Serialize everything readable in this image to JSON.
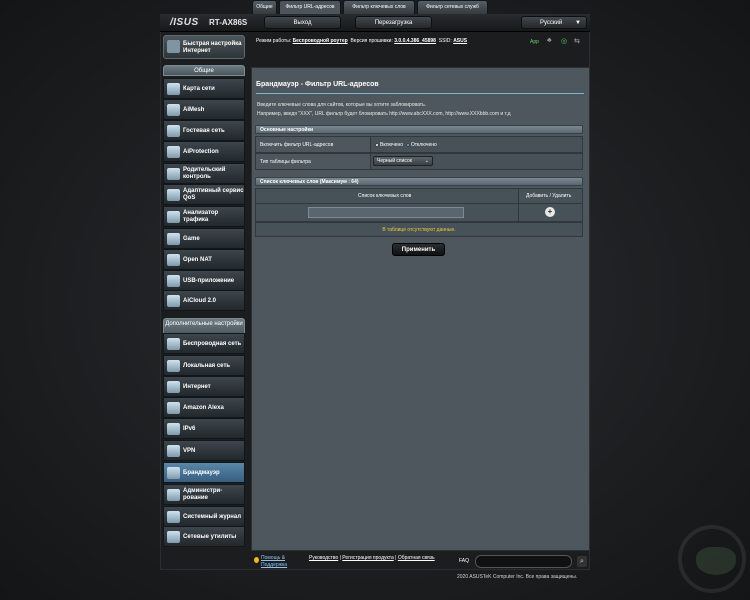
{
  "header": {
    "brand": "/ISUS",
    "model": "RT-AX86S",
    "logout_label": "Выход",
    "reboot_label": "Перезагрузка",
    "language": "Русский"
  },
  "status": {
    "mode_label": "Режим работы:",
    "mode_value": "Беспроводной роутер",
    "fw_label": "Версия прошивки:",
    "fw_value": "3.0.0.4.386_45898",
    "ssid_label": "SSID:",
    "ssid_value": "ASUS",
    "app_label": "App"
  },
  "sidebar": {
    "quick_setup": "Быстрая настройка Интернет",
    "general_header": "Общие",
    "general_items": [
      {
        "label": "Карта сети"
      },
      {
        "label": "AiMesh"
      },
      {
        "label": "Гостевая сеть"
      },
      {
        "label": "AiProtection"
      },
      {
        "label": "Родительский контроль"
      },
      {
        "label": "Адаптивный сервис QoS"
      },
      {
        "label": "Анализатор трафика"
      },
      {
        "label": "Game"
      },
      {
        "label": "Open NAT"
      },
      {
        "label": "USB-приложение"
      },
      {
        "label": "AiCloud 2.0"
      }
    ],
    "advanced_header": "Дополнительные настройки",
    "advanced_items": [
      {
        "label": "Беспроводная сеть"
      },
      {
        "label": "Локальная сеть"
      },
      {
        "label": "Интернет"
      },
      {
        "label": "Amazon Alexa"
      },
      {
        "label": "IPv6"
      },
      {
        "label": "VPN"
      },
      {
        "label": "Брандмауэр"
      },
      {
        "label": "Администри-рование"
      },
      {
        "label": "Системный журнал"
      },
      {
        "label": "Сетевые утилиты"
      }
    ]
  },
  "tabs": [
    {
      "label": "Общие"
    },
    {
      "label": "Фильтр URL-адресов"
    },
    {
      "label": "Фильтр ключевых слов"
    },
    {
      "label": "Фильтр сетевых служб"
    }
  ],
  "page": {
    "title": "Брандмауэр - Фильтр URL-адресов",
    "desc1": "Введите ключевые слова для сайтов, которые вы хотите заблокировать.",
    "desc2": "Например, введя \"XXX\", URL фильтр будет блокировать http://www.abcXXX.com, http://www.XXXbbb.com и т.д",
    "basic_header": "Основные настройки",
    "enable_label": "Включить фильтр URL-адресов",
    "enabled_opt": "Включено",
    "disabled_opt": "Отключено",
    "table_type_label": "Тип таблицы фильтра",
    "table_type_value": "Черный список",
    "list_header": "Список ключевых слов (Максимум : 64)",
    "col_keywords": "Список ключевых слов",
    "col_add_remove": "Добавить / Удалить",
    "empty_text": "В таблице отсутствуют данные.",
    "apply_label": "Применить"
  },
  "footer": {
    "help": "Помощь & Поддержка",
    "manual": "Руководство",
    "reg": "Регистрация продукта",
    "feedback": "Обратная связь",
    "faq": "FAQ",
    "copyright": "2020 ASUSTeK Computer Inc. Все права защищены."
  }
}
